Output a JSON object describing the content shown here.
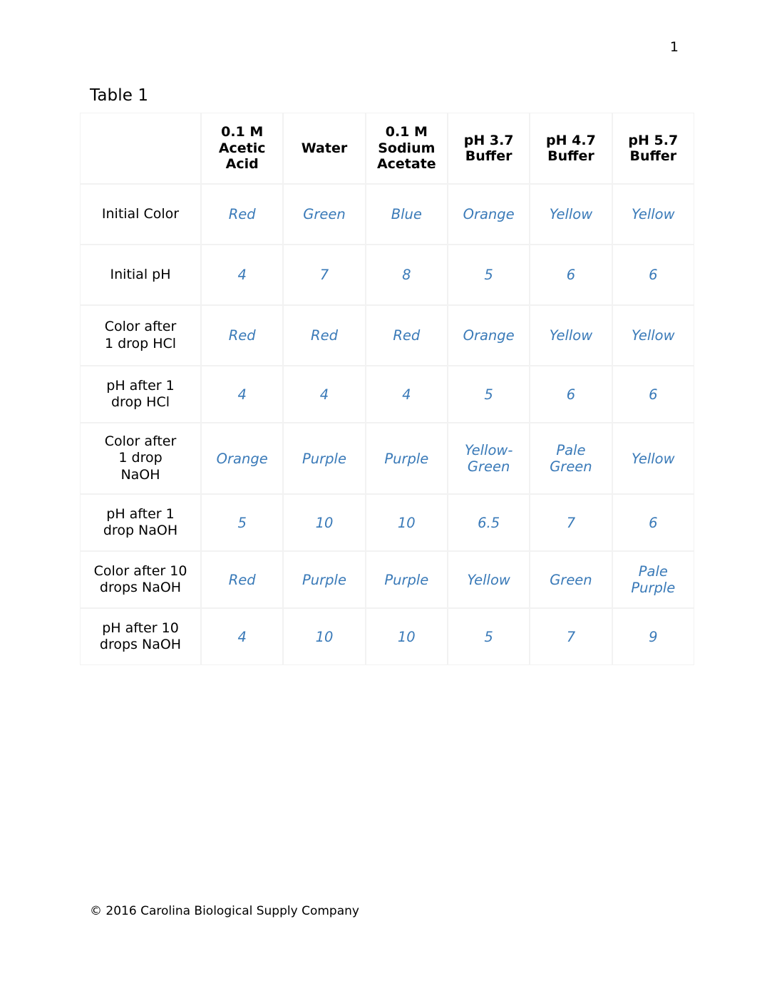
{
  "page": {
    "number": "1",
    "caption": "Table 1",
    "footer": "© 2016 Carolina Biological Supply Company"
  },
  "colors": {
    "value_text": "#3a7ab8",
    "label_text": "#000000",
    "gridline": "#f2f2f2",
    "background": "#ffffff"
  },
  "table": {
    "corner_label": "",
    "columns": [
      "0.1 M Acetic Acid",
      "Water",
      "0.1 M Sodium Acetate",
      "pH 3.7 Buffer",
      "pH 4.7 Buffer",
      "pH 5.7 Buffer"
    ],
    "column_lines": [
      [
        "0.1 M",
        "Acetic",
        "Acid"
      ],
      [
        "Water"
      ],
      [
        "0.1 M",
        "Sodium",
        "Acetate"
      ],
      [
        "pH 3.7",
        "Buffer"
      ],
      [
        "pH 4.7",
        "Buffer"
      ],
      [
        "pH 5.7",
        "Buffer"
      ]
    ],
    "rows": [
      {
        "label": "Initial Color",
        "label_lines": [
          "Initial Color"
        ],
        "values": [
          "Red",
          "Green",
          "Blue",
          "Orange",
          "Yellow",
          "Yellow"
        ],
        "value_lines": [
          [
            "Red"
          ],
          [
            "Green"
          ],
          [
            "Blue"
          ],
          [
            "Orange"
          ],
          [
            "Yellow"
          ],
          [
            "Yellow"
          ]
        ]
      },
      {
        "label": "Initial pH",
        "label_lines": [
          "Initial pH"
        ],
        "values": [
          "4",
          "7",
          "8",
          "5",
          "6",
          "6"
        ],
        "value_lines": [
          [
            "4"
          ],
          [
            "7"
          ],
          [
            "8"
          ],
          [
            "5"
          ],
          [
            "6"
          ],
          [
            "6"
          ]
        ]
      },
      {
        "label": "Color after 1 drop HCl",
        "label_lines": [
          "Color after",
          "1 drop HCl"
        ],
        "values": [
          "Red",
          "Red",
          "Red",
          "Orange",
          "Yellow",
          "Yellow"
        ],
        "value_lines": [
          [
            "Red"
          ],
          [
            "Red"
          ],
          [
            "Red"
          ],
          [
            "Orange"
          ],
          [
            "Yellow"
          ],
          [
            "Yellow"
          ]
        ]
      },
      {
        "label": "pH after 1 drop HCl",
        "label_lines": [
          "pH after 1",
          "drop HCl"
        ],
        "values": [
          "4",
          "4",
          "4",
          "5",
          "6",
          "6"
        ],
        "value_lines": [
          [
            "4"
          ],
          [
            "4"
          ],
          [
            "4"
          ],
          [
            "5"
          ],
          [
            "6"
          ],
          [
            "6"
          ]
        ]
      },
      {
        "label": "Color after 1 drop NaOH",
        "label_lines": [
          "Color after",
          "1 drop",
          "NaOH"
        ],
        "values": [
          "Orange",
          "Purple",
          "Purple",
          "Yellow-Green",
          "Pale Green",
          "Yellow"
        ],
        "value_lines": [
          [
            "Orange"
          ],
          [
            "Purple"
          ],
          [
            "Purple"
          ],
          [
            "Yellow-",
            "Green"
          ],
          [
            "Pale",
            "Green"
          ],
          [
            "Yellow"
          ]
        ]
      },
      {
        "label": "pH after 1 drop NaOH",
        "label_lines": [
          "pH after 1",
          "drop NaOH"
        ],
        "values": [
          "5",
          "10",
          "10",
          "6.5",
          "7",
          "6"
        ],
        "value_lines": [
          [
            "5"
          ],
          [
            "10"
          ],
          [
            "10"
          ],
          [
            "6.5"
          ],
          [
            "7"
          ],
          [
            "6"
          ]
        ]
      },
      {
        "label": "Color after 10 drops NaOH",
        "label_lines": [
          "Color after 10",
          "drops NaOH"
        ],
        "values": [
          "Red",
          "Purple",
          "Purple",
          "Yellow",
          "Green",
          "Pale Purple"
        ],
        "value_lines": [
          [
            "Red"
          ],
          [
            "Purple"
          ],
          [
            "Purple"
          ],
          [
            "Yellow"
          ],
          [
            "Green"
          ],
          [
            "Pale",
            "Purple"
          ]
        ]
      },
      {
        "label": "pH after 10 drops NaOH",
        "label_lines": [
          "pH after 10",
          "drops NaOH"
        ],
        "values": [
          "4",
          "10",
          "10",
          "5",
          "7",
          "9"
        ],
        "value_lines": [
          [
            "4"
          ],
          [
            "10"
          ],
          [
            "10"
          ],
          [
            "5"
          ],
          [
            "7"
          ],
          [
            "9"
          ]
        ]
      }
    ]
  }
}
